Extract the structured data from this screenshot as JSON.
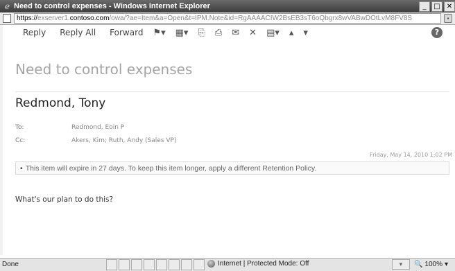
{
  "window": {
    "title": "Need to control expenses - Windows Internet Explorer",
    "minimize_icon": "minimize-icon",
    "maximize_icon": "maximize-icon",
    "close_icon": "close-icon"
  },
  "address": {
    "scheme": "https://",
    "host_prefix": "exserver1.",
    "host": "contoso.com",
    "path": "/owa/?ae=Item&a=Open&t=IPM.Note&id=RgAAAACIW2BsEB3sT6oQbgrx8wVABwDOtLvM8FV8S"
  },
  "toolbar": {
    "reply": "Reply",
    "reply_all": "Reply All",
    "forward": "Forward",
    "icons": [
      "flag-icon",
      "categorize-icon",
      "move-icon",
      "print-icon",
      "open-icon",
      "delete-icon",
      "more-actions-icon",
      "previous-item-icon",
      "next-item-icon"
    ],
    "help_label": "?"
  },
  "message": {
    "subject": "Need to control expenses",
    "sender": "Redmond, Tony",
    "to_label": "To:",
    "to_value": "Redmond, Eoin P",
    "cc_label": "Cc:",
    "cc_value": "Akers, Kim; Ruth, Andy (Sales VP)",
    "date": "Friday, May 14, 2010 1:02 PM",
    "retention_notice": "This item will expire in 27 days. To keep this item longer, apply a different Retention Policy.",
    "body": "What's our plan to do this?"
  },
  "status": {
    "state": "Done",
    "zone": "Internet | Protected Mode: Off",
    "zoom": "100%"
  }
}
